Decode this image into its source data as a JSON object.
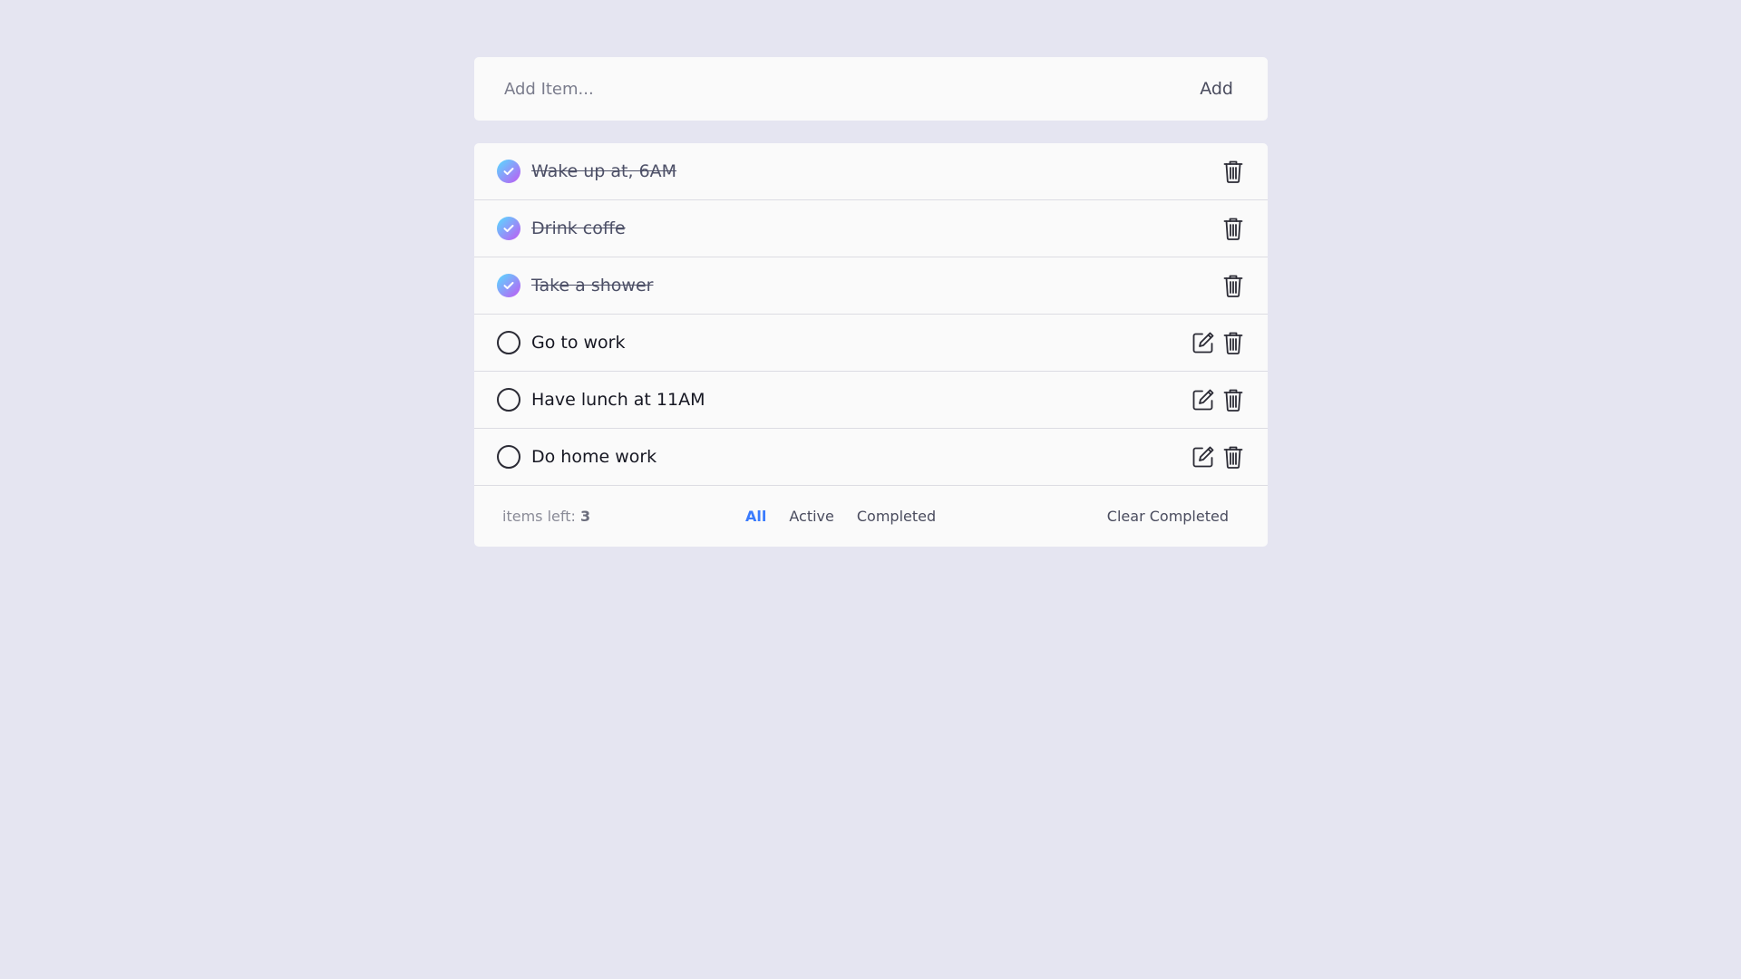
{
  "add": {
    "placeholder": "Add Item...",
    "button_label": "Add"
  },
  "todos": [
    {
      "text": "Wake up at, 6AM",
      "completed": true
    },
    {
      "text": "Drink coffe",
      "completed": true
    },
    {
      "text": "Take a shower",
      "completed": true
    },
    {
      "text": "Go to work",
      "completed": false
    },
    {
      "text": "Have lunch at 11AM",
      "completed": false
    },
    {
      "text": "Do home work",
      "completed": false
    }
  ],
  "footer": {
    "items_left_label": "items left:",
    "items_left_count": "3",
    "filters": [
      "All",
      "Active",
      "Completed"
    ],
    "active_filter": "All",
    "clear_label": "Clear Completed"
  },
  "colors": {
    "background": "#e5e5f1",
    "card": "#fafafa",
    "accent": "#3a7bfd",
    "check_gradient_start": "#57ddff",
    "check_gradient_end": "#c058f3"
  },
  "icons": {
    "check": "check-icon",
    "edit": "edit-icon",
    "delete": "trash-icon"
  }
}
